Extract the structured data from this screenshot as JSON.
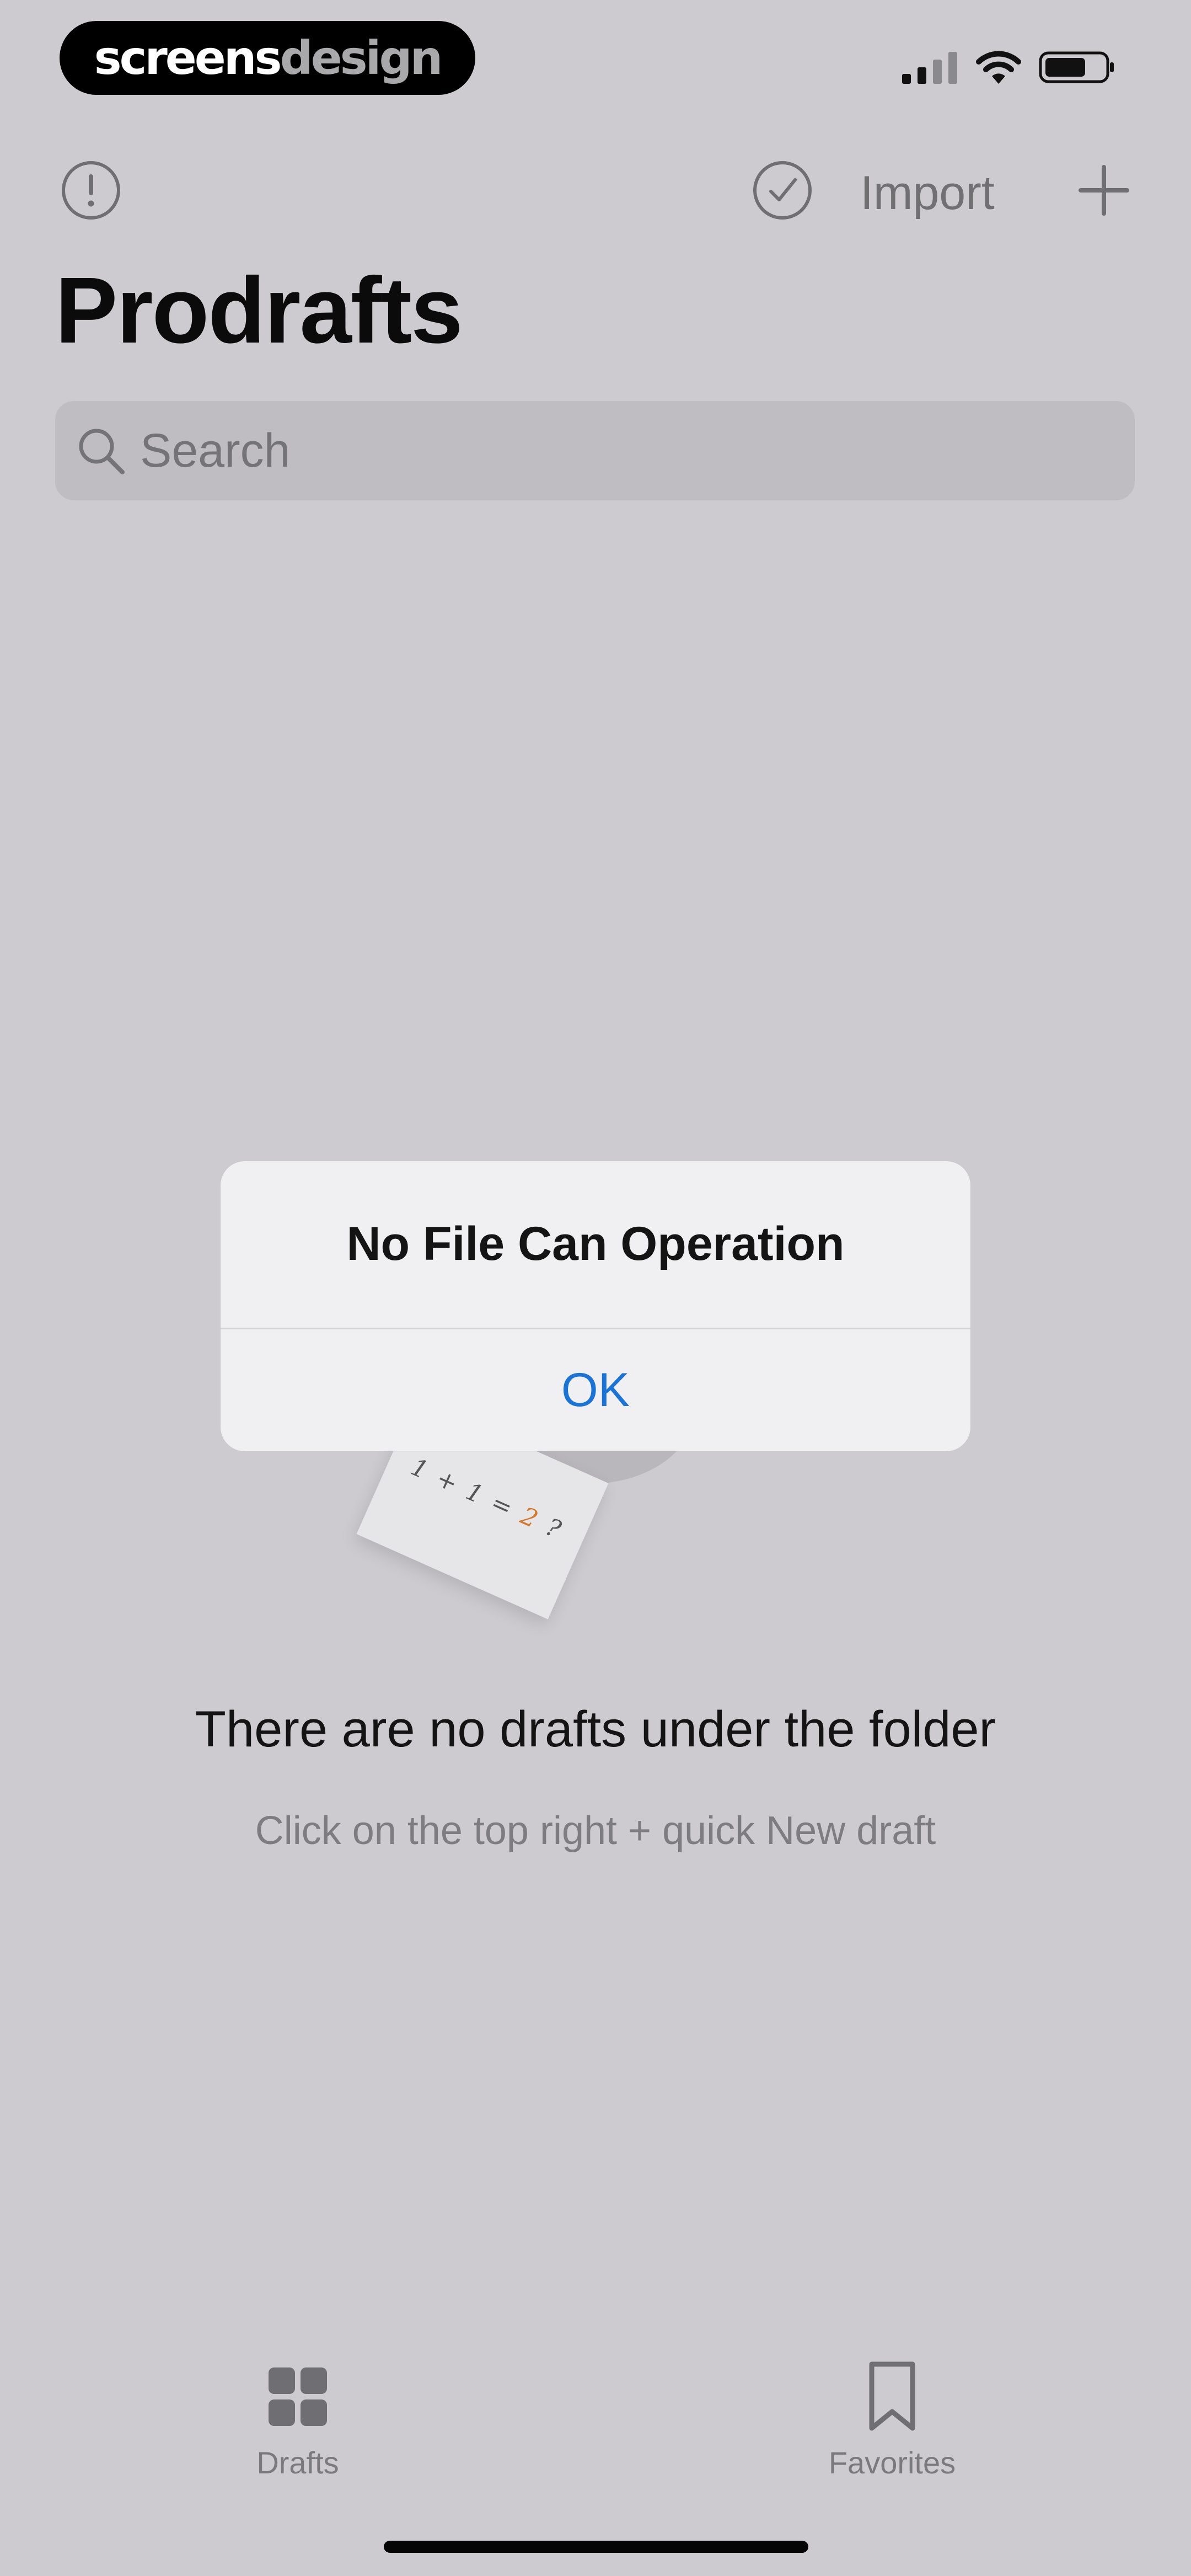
{
  "status_bar": {
    "brand_part_one": "screens",
    "brand_part_two": "design",
    "signal_icon": "cellular-signal-icon",
    "wifi_icon": "wifi-icon",
    "battery_icon": "battery-icon"
  },
  "nav": {
    "info_icon": "info-circle-icon",
    "select_icon": "checkmark-circle-icon",
    "import_label": "Import",
    "add_icon": "plus-icon"
  },
  "header": {
    "title": "Prodrafts"
  },
  "search": {
    "placeholder": "Search",
    "value": ""
  },
  "illustration": {
    "formula_prefix": "1 + 1 = ",
    "formula_accent": "2",
    "formula_suffix": " ?"
  },
  "alert": {
    "title": "No File Can Operation",
    "ok_label": "OK"
  },
  "empty_state": {
    "title": "There are no drafts under the folder",
    "subtitle": "Click on the top right + quick New draft"
  },
  "tab_bar": {
    "items": [
      {
        "label": "Drafts",
        "icon": "grid-icon"
      },
      {
        "label": "Favorites",
        "icon": "bookmark-icon"
      }
    ]
  },
  "colors": {
    "background": "#cdcbcf",
    "alert_background": "#f0eff1",
    "alert_button": "#1a74d8",
    "accent_orange": "#d4772a"
  }
}
